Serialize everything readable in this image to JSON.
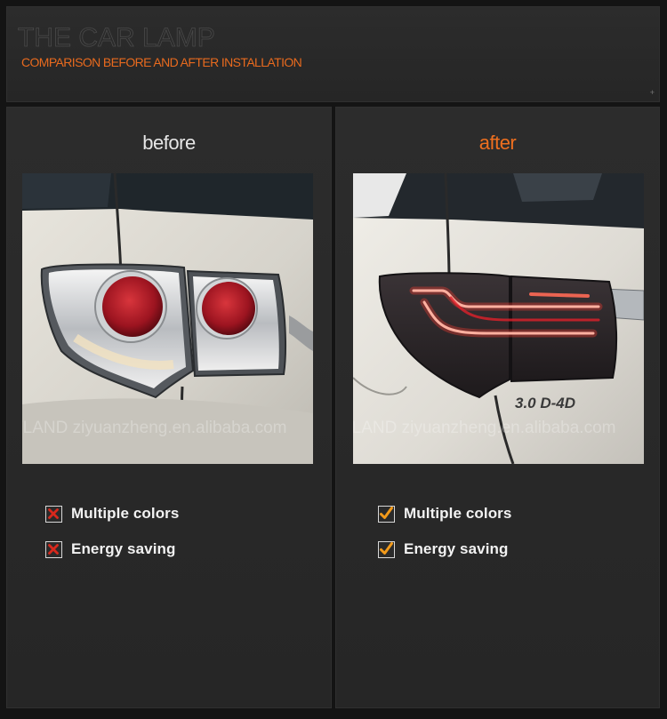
{
  "header": {
    "title": "THE CAR LAMP",
    "subtitle": "COMPARISON BEFORE AND AFTER INSTALLATION",
    "plus_mark": "+"
  },
  "before": {
    "label": "before",
    "photo_watermark": "VLAND ziyuanzheng.en.alibaba.com",
    "features": [
      {
        "text": "Multiple colors",
        "status": "no"
      },
      {
        "text": "Energy saving",
        "status": "no"
      }
    ]
  },
  "after": {
    "label": "after",
    "photo_watermark": "VLAND ziyuanzheng.en.alibaba.com",
    "badge_text": "3.0 D-4D",
    "features": [
      {
        "text": "Multiple colors",
        "status": "yes"
      },
      {
        "text": "Energy saving",
        "status": "yes"
      }
    ]
  },
  "colors": {
    "accent_orange": "#ee6f1f",
    "cross_red": "#d8281c",
    "check_orange": "#f29a1a",
    "panel_bg": "#2a2a2a"
  },
  "icons": {
    "cross": "cross-icon",
    "check": "check-icon"
  }
}
